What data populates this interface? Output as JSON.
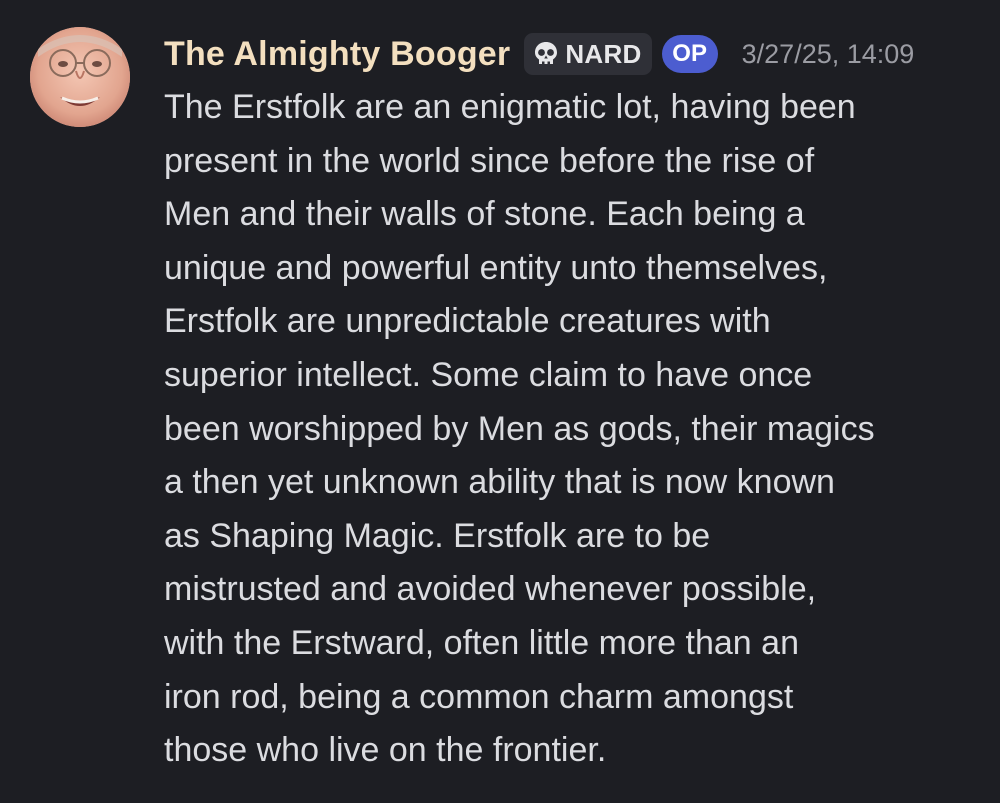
{
  "message": {
    "author": "The Almighty Booger",
    "server_tag": {
      "icon": "skull-icon",
      "label": "NARD"
    },
    "badge": "OP",
    "timestamp": "3/27/25, 14:09",
    "content": "The Erstfolk are an enigmatic lot, having been\npresent in the world since before the rise of\nMen and their walls of stone. Each being a\nunique and powerful entity unto themselves,\nErstfolk are unpredictable creatures with\nsuperior intellect. Some claim to have once\nbeen worshipped by Men as gods, their magics\na then yet unknown ability that is now known\nas Shaping Magic. Erstfolk are to be\nmistrusted and avoided whenever possible,\nwith the Erstward, often little more than an\niron rod, being a common charm amongst\nthose who live on the frontier."
  },
  "colors": {
    "background": "#1d1e23",
    "username": "#f3dfbf",
    "op_badge": "#4c5dd0",
    "body_text": "#dbdce0",
    "timestamp": "#9b9ca3"
  }
}
